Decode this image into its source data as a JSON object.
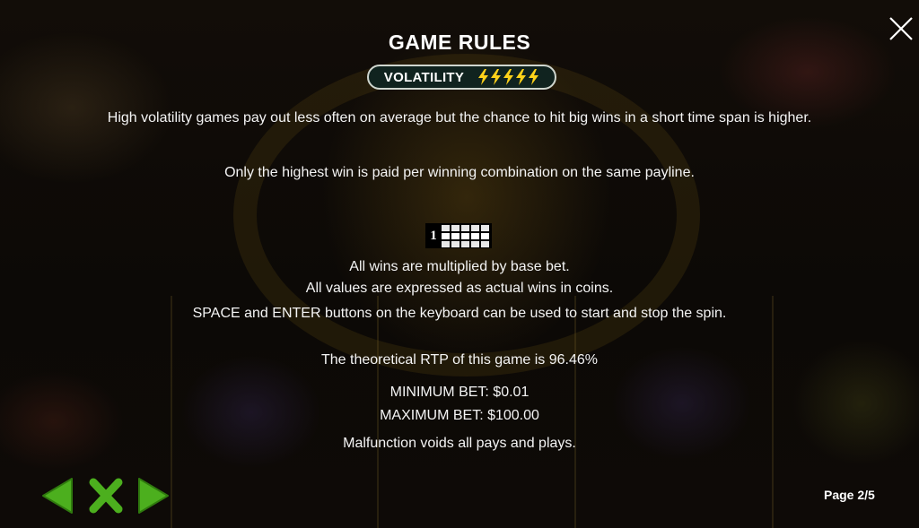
{
  "title": "GAME RULES",
  "volatility": {
    "label": "VOLATILITY",
    "level": 5,
    "max": 5,
    "icon": "lightning-bolt-icon",
    "color": "#ffd21a"
  },
  "paragraphs": {
    "volatility_desc": "High volatility games pay out less often on average but the chance to hit big wins in a short time span is higher.",
    "highest_win": "Only the highest win is paid per winning combination on the same payline."
  },
  "payline": {
    "number": "1"
  },
  "rules": {
    "multiplied": "All wins are multiplied by base bet.",
    "values": "All values are expressed as actual wins in coins.",
    "keyboard": "SPACE and ENTER buttons on the keyboard can be used to start and stop the spin.",
    "rtp": "The theoretical RTP of this game is 96.46%",
    "min_bet": "MINIMUM BET: $0.01",
    "max_bet": "MAXIMUM BET: $100.00",
    "malfunction": "Malfunction voids all pays and plays."
  },
  "navigation": {
    "page": "Page 2/5",
    "prev_icon": "arrow-left-icon",
    "close_icon": "close-x-icon",
    "next_icon": "arrow-right-icon",
    "accent": "#4caf1e"
  },
  "close_icon": "close-icon"
}
